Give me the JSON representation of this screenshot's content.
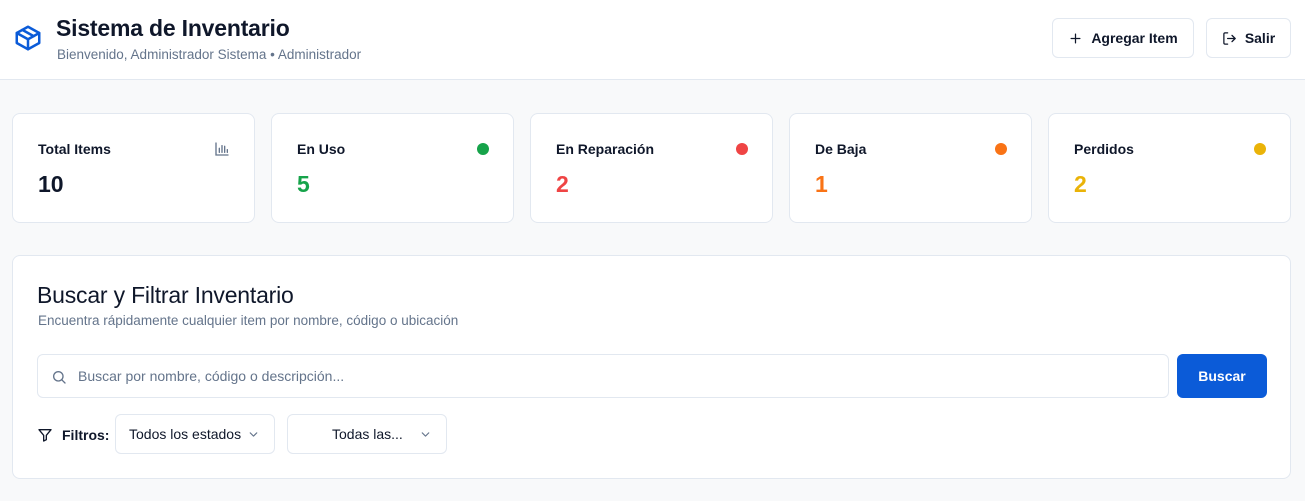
{
  "header": {
    "title": "Sistema de Inventario",
    "subtitle": "Bienvenido, Administrador Sistema • Administrador",
    "logo_icon": "package-icon",
    "add_button_label": "Agregar Item",
    "add_button_icon": "plus-icon",
    "exit_button_label": "Salir",
    "exit_button_icon": "logout-icon"
  },
  "stats": [
    {
      "label": "Total Items",
      "value": "10",
      "indicator": "bar-chart-icon",
      "color": "#0f172a"
    },
    {
      "label": "En Uso",
      "value": "5",
      "indicator": "dot",
      "color": "#16a34a"
    },
    {
      "label": "En Reparación",
      "value": "2",
      "indicator": "dot",
      "color": "#ef4444"
    },
    {
      "label": "De Baja",
      "value": "1",
      "indicator": "dot",
      "color": "#f97316"
    },
    {
      "label": "Perdidos",
      "value": "2",
      "indicator": "dot",
      "color": "#eab308"
    }
  ],
  "search": {
    "title": "Buscar y Filtrar Inventario",
    "description": "Encuentra rápidamente cualquier item por nombre, código o ubicación",
    "input_value": "",
    "placeholder": "Buscar por nombre, código o descripción...",
    "button_label": "Buscar",
    "button_color": "#0b5bd8",
    "filters_label": "Filtros:",
    "status_select": "Todos los estados",
    "category_select": "Todas las..."
  }
}
